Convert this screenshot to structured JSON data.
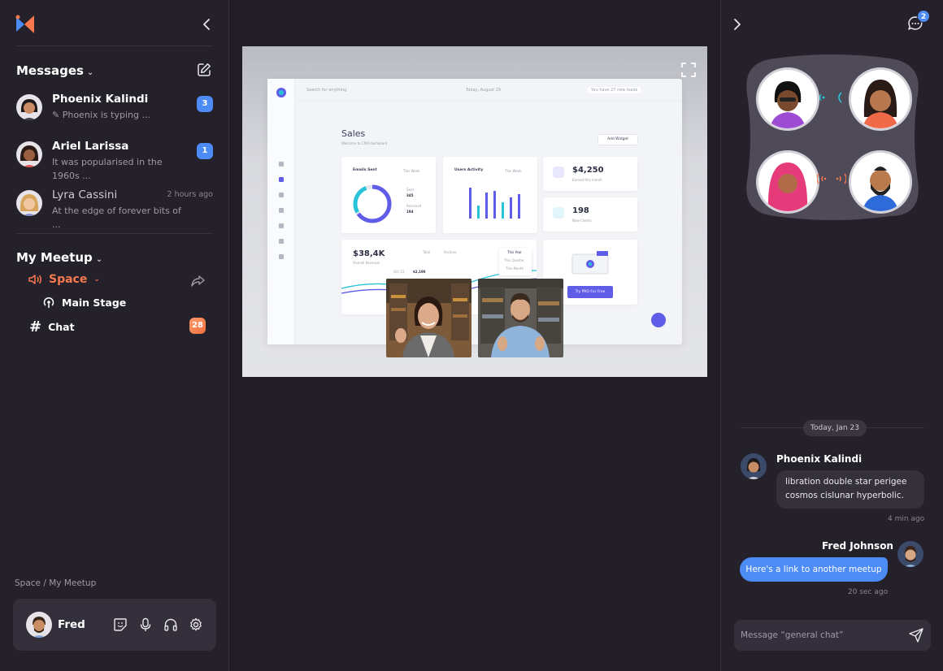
{
  "sidebar": {
    "messages_title": "Messages",
    "messages": [
      {
        "name": "Phoenix Kalindi",
        "preview": "Phoenix is typing ...",
        "badge": "3"
      },
      {
        "name": "Ariel Larissa",
        "preview": "It was popularised in the 1960s ...",
        "badge": "1"
      },
      {
        "name": "Lyra Cassini",
        "preview": "At the edge of forever bits of  ...",
        "time": "2 hours ago"
      }
    ],
    "meetup_title": "My Meetup",
    "space_label": "Space",
    "stage_label": "Main Stage",
    "chat_label": "Chat",
    "chat_badge": "28",
    "breadcrumb": "Space / My Meetup",
    "user": {
      "name": "Fred"
    }
  },
  "stage": {
    "dashboard": {
      "search_placeholder": "Search for anything",
      "date": "Today, August 29",
      "notice": "You have 27 new leads",
      "title": "Sales",
      "subtitle": "Welcome to CRM dashboard",
      "add_widget": "Add Widget",
      "emails_title": "Emails Sent",
      "emails_filter": "This Week",
      "emails_sent_label": "Sent",
      "emails_sent_value": "345",
      "emails_recv_label": "Received",
      "emails_recv_value": "194",
      "activity_title": "Users Activity",
      "activity_filter": "This Week",
      "stat1_value": "$4,250",
      "stat1_label": "Earned this month",
      "stat2_value": "198",
      "stat2_label": "New Clients",
      "revenue_value": "$38,4K",
      "revenue_label": "Overall Revenue",
      "legend_total": "Total",
      "legend_positive": "Positive",
      "menu_year": "This Year",
      "menu_quarter": "This Quarter",
      "menu_month": "This Month",
      "tooltip_date": "Oct 23",
      "tooltip_value": "$2,190",
      "promo_button": "Try PRO For Free"
    }
  },
  "right": {
    "notification_count": "2",
    "date_label": "Today, Jan 23",
    "messages": [
      {
        "author": "Phoenix Kalindi",
        "text": "libration double star perigee cosmos cislunar hyperbolic.",
        "time": "4 min ago"
      },
      {
        "author": "Fred Johnson",
        "text": "Here's a link to another meetup",
        "time": "20 sec ago"
      }
    ],
    "composer_placeholder": "Message “general chat”"
  },
  "colors": {
    "accent": "#4d8bf5",
    "space": "#f7784e",
    "chat_badge": "#f1703d"
  }
}
